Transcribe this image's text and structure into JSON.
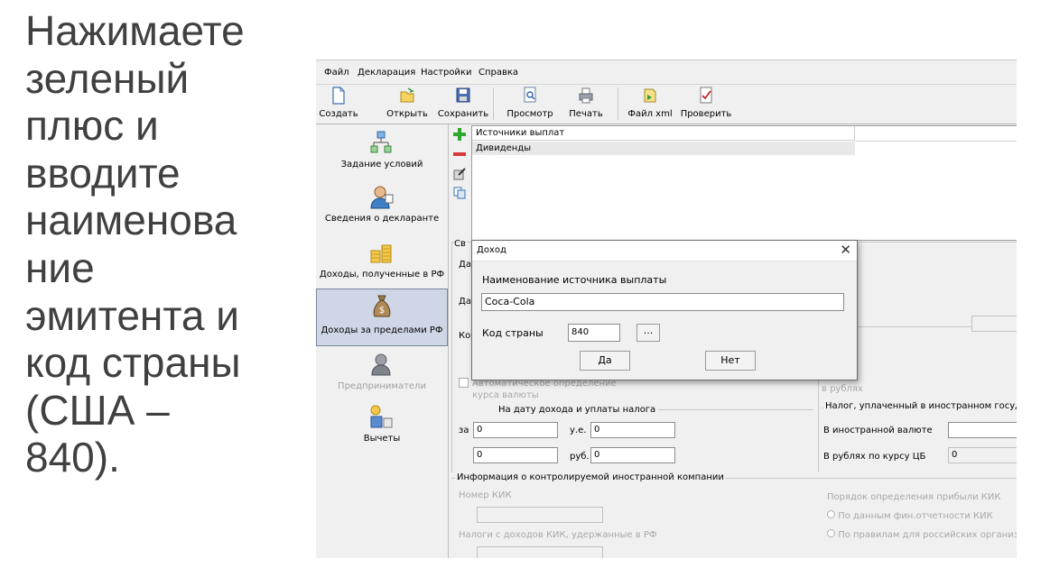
{
  "slide": {
    "lines": [
      "Нажимаете",
      "зеленый",
      "плюс и",
      "вводите",
      "наименова",
      "ние",
      "эмитента и",
      "код страны",
      "(США –",
      "840)."
    ]
  },
  "menu": [
    "Файл",
    "Декларация",
    "Настройки",
    "Справка"
  ],
  "toolbar": {
    "create": "Создать",
    "open": "Открыть",
    "save": "Сохранить",
    "preview": "Просмотр",
    "print": "Печать",
    "xml": "Файл xml",
    "check": "Проверить"
  },
  "sidebar": {
    "items": [
      {
        "label": "Задание условий"
      },
      {
        "label": "Сведения о декларанте"
      },
      {
        "label": "Доходы, полученные в РФ"
      },
      {
        "label": "Доходы за пределами РФ"
      },
      {
        "label": "Предприниматели"
      },
      {
        "label": "Вычеты"
      }
    ]
  },
  "list": {
    "header": "Источники выплат",
    "rows": [
      "Дивиденды"
    ]
  },
  "lower": {
    "sv_clip": "Св",
    "da1": "Да",
    "da2": "Да",
    "ko": "Ко",
    "ellipsis": "...",
    "auto_rate": "Автоматическое определение курса валюты",
    "v_rublyah": "в рублях",
    "date_group": "На дату дохода и уплаты налога",
    "za": "за",
    "za_value": "0",
    "ue": "у.е.",
    "ue_value": "0",
    "row2_value": "0",
    "rub": "руб.",
    "rub_value": "0",
    "foreign_tax_group": "Налог, уплаченный в иностранном государстве",
    "in_foreign_currency": "В иностранной валюте",
    "in_rub_cb": "В рублях по курсу ЦБ",
    "rub_cb_value": "0",
    "kik_group": "Информация о контролируемой иностранной компании",
    "kik_number": "Номер КИК",
    "kik_taxes": "Налоги с доходов КИК, удержанные в РФ",
    "profit_order": "Порядок определения прибыли КИК",
    "radio1": "По данным фин.отчетности КИК",
    "radio2": "По правилам для российских организаций"
  },
  "dialog": {
    "title": "Доход",
    "close": "✕",
    "source_label": "Наименование источника выплаты",
    "source_value": "Coca-Cola",
    "country_label": "Код страны",
    "country_value": "840",
    "browse": "...",
    "yes": "Да",
    "no": "Нет"
  }
}
